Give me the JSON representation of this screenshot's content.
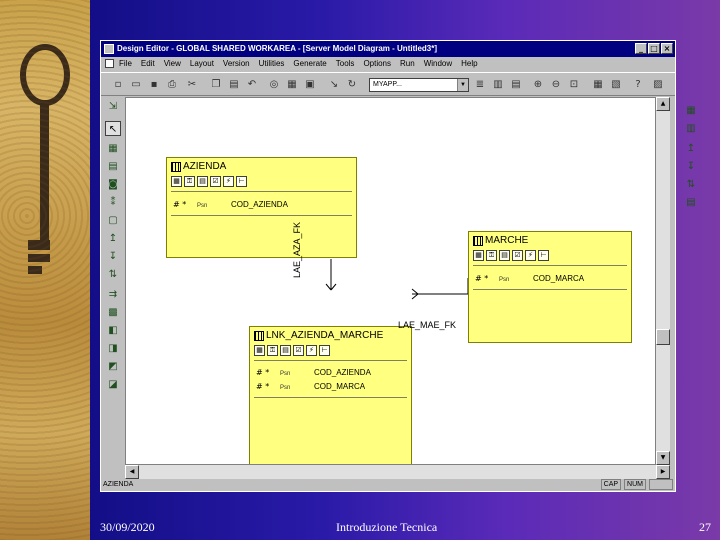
{
  "slide": {
    "date": "30/09/2020",
    "title": "Introduzione Tecnica",
    "page": "27"
  },
  "window": {
    "title": "Design Editor - GLOBAL SHARED WORKAREA - [Server Model Diagram - Untitled3*]",
    "buttons": [
      "_",
      "□",
      "×"
    ]
  },
  "menu": {
    "items": [
      "File",
      "Edit",
      "View",
      "Layout",
      "Version",
      "Utilities",
      "Generate",
      "Tools",
      "Options",
      "Run",
      "Window",
      "Help"
    ]
  },
  "toolbar": {
    "app_select_value": "MYAPP..."
  },
  "entities": [
    {
      "name": "AZIENDA",
      "columns": [
        {
          "flags": "# *",
          "type": "Psn",
          "name": "COD_AZIENDA"
        }
      ]
    },
    {
      "name": "MARCHE",
      "columns": [
        {
          "flags": "# *",
          "type": "Psn",
          "name": "COD_MARCA"
        }
      ]
    },
    {
      "name": "LNK_AZIENDA_MARCHE",
      "columns": [
        {
          "flags": "# *",
          "type": "Psn",
          "name": "COD_AZIENDA"
        },
        {
          "flags": "# *",
          "type": "Psn",
          "name": "COD_MARCA"
        }
      ]
    }
  ],
  "relations": {
    "fk1": "LAE_AZA_FK",
    "fk2": "LAE_MAE_FK"
  },
  "status": {
    "left": "AZIENDA",
    "indicators": [
      "CAP",
      "NUM"
    ]
  },
  "icons": {
    "key": "key-image",
    "colors": {
      "entity_fill": "#ffff80",
      "title_bar": "#000080"
    }
  }
}
